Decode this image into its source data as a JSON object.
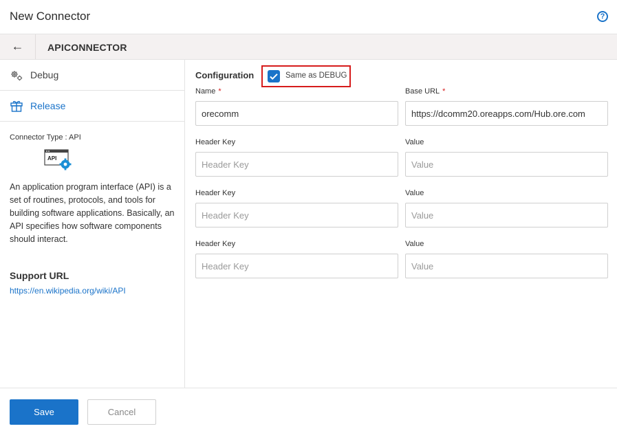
{
  "header": {
    "title": "New Connector",
    "help_icon": "?"
  },
  "subbar": {
    "back_icon": "←",
    "connector_name": "APICONNECTOR"
  },
  "sidebar": {
    "items": [
      {
        "label": "Debug",
        "icon": "gears-icon"
      },
      {
        "label": "Release",
        "icon": "box-icon"
      }
    ],
    "connector_type_label": "Connector Type :",
    "connector_type_value": "API",
    "api_icon_text": "API",
    "description": "An application program interface (API) is a set of routines, protocols, and tools for building software applications. Basically, an API specifies how software components should interact.",
    "support_title": "Support URL",
    "support_url": "https://en.wikipedia.org/wiki/API"
  },
  "config": {
    "title": "Configuration",
    "same_as_debug_label": "Same as DEBUG",
    "same_as_debug_checked": true,
    "name_label": "Name",
    "name_value": "orecomm",
    "base_url_label": "Base URL",
    "base_url_value": "https://dcomm20.oreapps.com/Hub.ore.com",
    "required_mark": "*",
    "headers": [
      {
        "key_label": "Header Key",
        "key_placeholder": "Header Key",
        "value_label": "Value",
        "value_placeholder": "Value"
      },
      {
        "key_label": "Header Key",
        "key_placeholder": "Header Key",
        "value_label": "Value",
        "value_placeholder": "Value"
      },
      {
        "key_label": "Header Key",
        "key_placeholder": "Header Key",
        "value_label": "Value",
        "value_placeholder": "Value"
      }
    ]
  },
  "footer": {
    "save_label": "Save",
    "cancel_label": "Cancel"
  },
  "colors": {
    "accent": "#1a73c9",
    "highlight": "#d61b1b",
    "subbar_bg": "#f4f1f1"
  }
}
